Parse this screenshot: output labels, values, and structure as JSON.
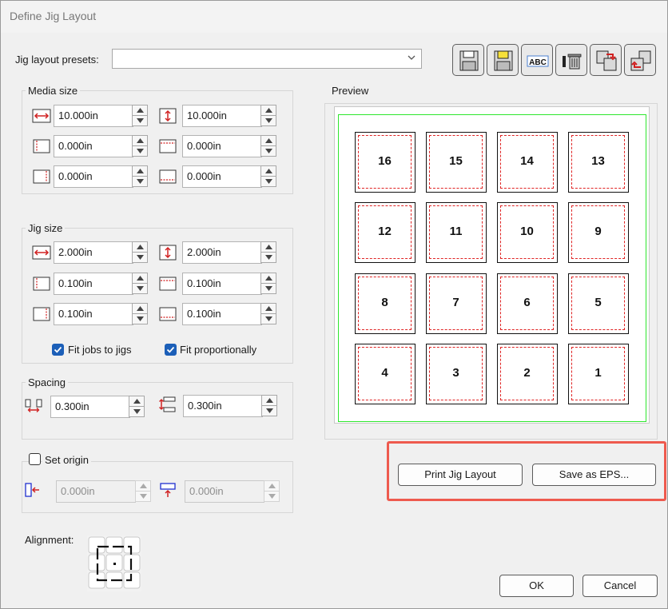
{
  "window": {
    "title": "Define Jig Layout"
  },
  "presets": {
    "label": "Jig layout presets:",
    "value": ""
  },
  "toolbar": [
    {
      "name": "save-icon"
    },
    {
      "name": "save-as-icon"
    },
    {
      "name": "rename-icon"
    },
    {
      "name": "delete-icon"
    },
    {
      "name": "import-icon"
    },
    {
      "name": "export-icon"
    }
  ],
  "media_size": {
    "title": "Media size",
    "width": "10.000in",
    "height": "10.000in",
    "left_margin": "0.000in",
    "top_margin": "0.000in",
    "right_margin": "0.000in",
    "bottom_margin": "0.000in"
  },
  "jig_size": {
    "title": "Jig size",
    "width": "2.000in",
    "height": "2.000in",
    "left_margin": "0.100in",
    "top_margin": "0.100in",
    "right_margin": "0.100in",
    "bottom_margin": "0.100in",
    "fit_jobs_label": "Fit jobs to jigs",
    "fit_jobs_checked": true,
    "fit_prop_label": "Fit proportionally",
    "fit_prop_checked": true
  },
  "spacing": {
    "title": "Spacing",
    "horizontal": "0.300in",
    "vertical": "0.300in"
  },
  "origin": {
    "label": "Set origin",
    "checked": false,
    "x": "0.000in",
    "y": "0.000in"
  },
  "alignment": {
    "label": "Alignment:"
  },
  "preview": {
    "title": "Preview",
    "cells": [
      [
        "16",
        "15",
        "14",
        "13"
      ],
      [
        "12",
        "11",
        "10",
        "9"
      ],
      [
        "8",
        "7",
        "6",
        "5"
      ],
      [
        "4",
        "3",
        "2",
        "1"
      ]
    ]
  },
  "buttons": {
    "print": "Print Jig Layout",
    "save_eps": "Save as EPS...",
    "ok": "OK",
    "cancel": "Cancel"
  },
  "colors": {
    "accent": "#1c5fb8",
    "highlight": "#ee5a4e",
    "bounds": "#2ee62e",
    "cut": "#e02424"
  }
}
